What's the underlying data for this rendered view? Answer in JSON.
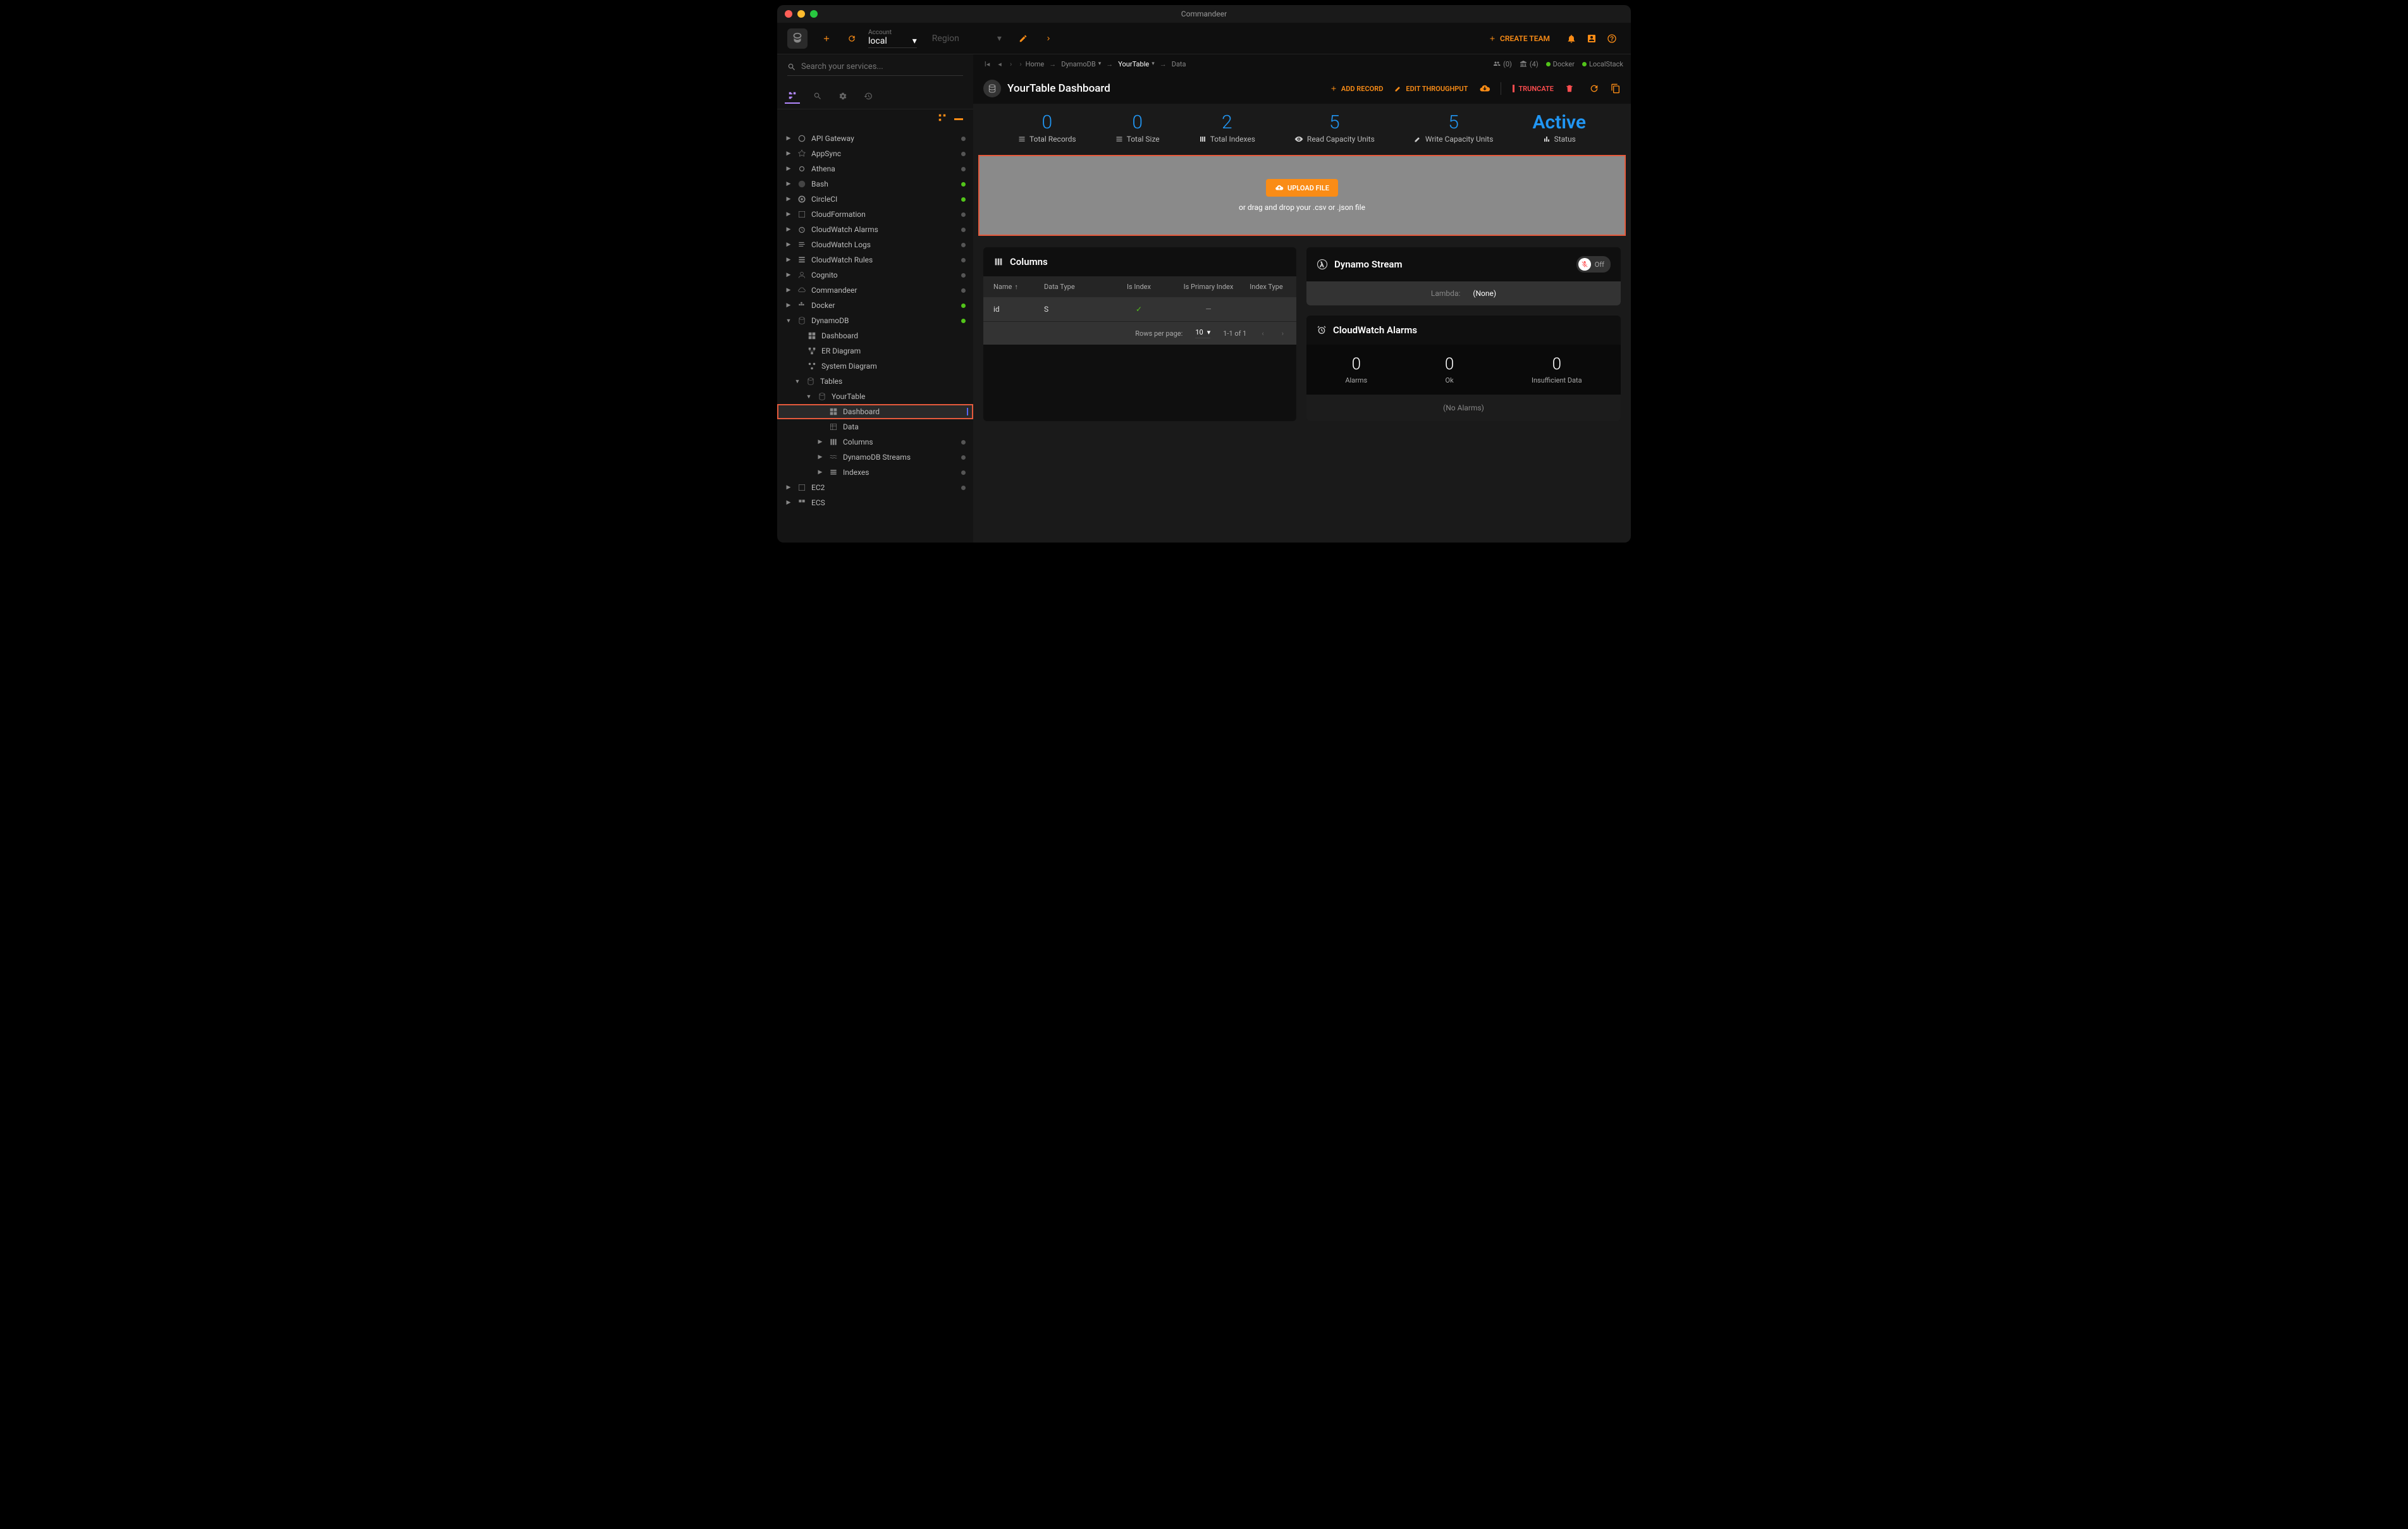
{
  "window": {
    "title": "Commandeer"
  },
  "header": {
    "account_label": "Account",
    "account_value": "local",
    "region_label": "Region",
    "create_team": "CREATE TEAM"
  },
  "search": {
    "placeholder": "Search your services..."
  },
  "breadcrumb": {
    "home": "Home",
    "service": "DynamoDB",
    "table": "YourTable",
    "page": "Data",
    "status": {
      "users": "(0)",
      "buildings": "(4)",
      "docker": "Docker",
      "localstack": "LocalStack"
    }
  },
  "page": {
    "title": "YourTable Dashboard",
    "actions": {
      "add_record": "ADD RECORD",
      "edit_throughput": "EDIT THROUGHPUT",
      "truncate": "TRUNCATE"
    }
  },
  "stats": [
    {
      "value": "0",
      "label": "Total Records"
    },
    {
      "value": "0",
      "label": "Total Size"
    },
    {
      "value": "2",
      "label": "Total Indexes"
    },
    {
      "value": "5",
      "label": "Read Capacity Units"
    },
    {
      "value": "5",
      "label": "Write Capacity Units"
    },
    {
      "value": "Active",
      "label": "Status"
    }
  ],
  "upload": {
    "button": "UPLOAD FILE",
    "hint": "or drag and drop your .csv or .json file"
  },
  "columns_card": {
    "title": "Columns",
    "headers": {
      "name": "Name",
      "data_type": "Data Type",
      "is_index": "Is Index",
      "is_primary": "Is Primary Index",
      "index_type": "Index Type"
    },
    "rows": [
      {
        "name": "id",
        "type": "S",
        "is_index": "✓",
        "is_primary": "—",
        "index_type": ""
      }
    ],
    "footer": {
      "rows_per_page": "Rows per page:",
      "rpp_value": "10",
      "range": "1-1 of 1"
    }
  },
  "stream_card": {
    "title": "Dynamo Stream",
    "toggle": "Off",
    "lambda_label": "Lambda:",
    "lambda_value": "(None)"
  },
  "alarms_card": {
    "title": "CloudWatch Alarms",
    "stats": [
      {
        "value": "0",
        "label": "Alarms"
      },
      {
        "value": "0",
        "label": "Ok"
      },
      {
        "value": "0",
        "label": "Insufficient Data"
      }
    ],
    "empty": "(No Alarms)"
  },
  "tree": {
    "services": [
      {
        "label": "API Gateway",
        "status": "gray"
      },
      {
        "label": "AppSync",
        "status": "gray"
      },
      {
        "label": "Athena",
        "status": "gray"
      },
      {
        "label": "Bash",
        "status": "green"
      },
      {
        "label": "CircleCI",
        "status": "green"
      },
      {
        "label": "CloudFormation",
        "status": "gray"
      },
      {
        "label": "CloudWatch Alarms",
        "status": "gray"
      },
      {
        "label": "CloudWatch Logs",
        "status": "gray"
      },
      {
        "label": "CloudWatch Rules",
        "status": "gray"
      },
      {
        "label": "Cognito",
        "status": "gray"
      },
      {
        "label": "Commandeer",
        "status": "gray"
      },
      {
        "label": "Docker",
        "status": "green"
      }
    ],
    "dynamodb": {
      "label": "DynamoDB",
      "children": [
        {
          "label": "Dashboard"
        },
        {
          "label": "ER Diagram"
        },
        {
          "label": "System Diagram"
        }
      ],
      "tables_label": "Tables",
      "your_table": {
        "label": "YourTable",
        "children": [
          {
            "label": "Dashboard",
            "selected": true
          },
          {
            "label": "Data"
          },
          {
            "label": "Columns",
            "caret": true,
            "status": "gray"
          },
          {
            "label": "DynamoDB Streams",
            "caret": true,
            "status": "gray"
          },
          {
            "label": "Indexes",
            "caret": true,
            "status": "gray"
          }
        ]
      }
    },
    "trailing": [
      {
        "label": "EC2",
        "status": "gray"
      },
      {
        "label": "ECS"
      }
    ]
  }
}
